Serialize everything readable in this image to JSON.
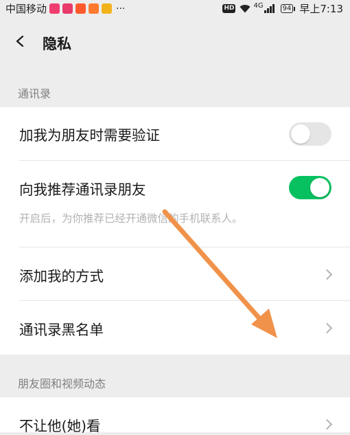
{
  "status_bar": {
    "carrier": "中国移动",
    "app_badges": [
      {
        "icon": "live-app-icon",
        "color": "#f03d70"
      },
      {
        "icon": "record-app-icon",
        "color": "#e83a6b"
      },
      {
        "icon": "video-app-icon",
        "color": "#ff5a2d"
      },
      {
        "icon": "image-app-icon",
        "color": "#ff7a2e"
      },
      {
        "icon": "game-app-icon",
        "color": "#f2b21c"
      }
    ],
    "more": "···",
    "hd": "HD",
    "network": "4G",
    "battery": "94",
    "time": "早上7:13"
  },
  "nav": {
    "title": "隐私"
  },
  "sections": {
    "contacts": {
      "header": "通讯录",
      "verify_label": "加我为朋友时需要验证",
      "verify_on": false,
      "recommend_label": "向我推荐通讯录朋友",
      "recommend_desc": "开启后，为你推荐已经开通微信的手机联系人。",
      "recommend_on": true,
      "add_methods_label": "添加我的方式",
      "blacklist_label": "通讯录黑名单"
    },
    "moments": {
      "header": "朋友圈和视频动态",
      "hide_from_label": "不让他(她)看"
    }
  },
  "colors": {
    "switch_on": "#07c160",
    "switch_off": "#e5e5e5",
    "annotation_arrow": "#f0924a"
  }
}
